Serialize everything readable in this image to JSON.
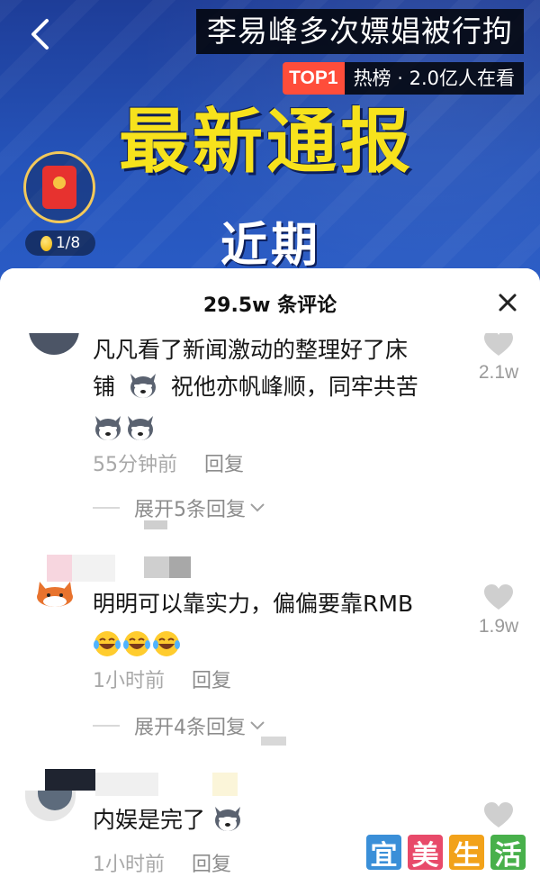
{
  "video": {
    "title": "李易峰多次嫖娼被行拘",
    "hot_badge": "TOP1",
    "hot_text": "热榜 · 2.0亿人在看",
    "headline": "最新通报",
    "sub_headline": "近期",
    "coin_progress": "1/8",
    "colors": {
      "headline": "#f7e21c",
      "badge": "#ff4d3a"
    }
  },
  "comments_panel": {
    "count_label": "29.5w 条评论",
    "comments": [
      {
        "text_line1": "凡凡看了新闻激动的整理好了床",
        "text_line2_prefix": "铺",
        "text_line2_suffix": "祝他亦帆峰顺，同牢共苦",
        "time": "55分钟前",
        "reply": "回复",
        "likes": "2.1w",
        "expand": "展开5条回复"
      },
      {
        "text": "明明可以靠实力，偏偏要靠RMB",
        "time": "1小时前",
        "reply": "回复",
        "likes": "1.9w",
        "expand": "展开4条回复"
      },
      {
        "text": "内娱是完了",
        "time": "1小时前",
        "reply": "回复",
        "likes": ""
      }
    ]
  },
  "watermark": {
    "chars": [
      "宜",
      "美",
      "生",
      "活"
    ],
    "colors": [
      "#3a8fd8",
      "#e84a6a",
      "#f2a21a",
      "#48b04b"
    ]
  }
}
